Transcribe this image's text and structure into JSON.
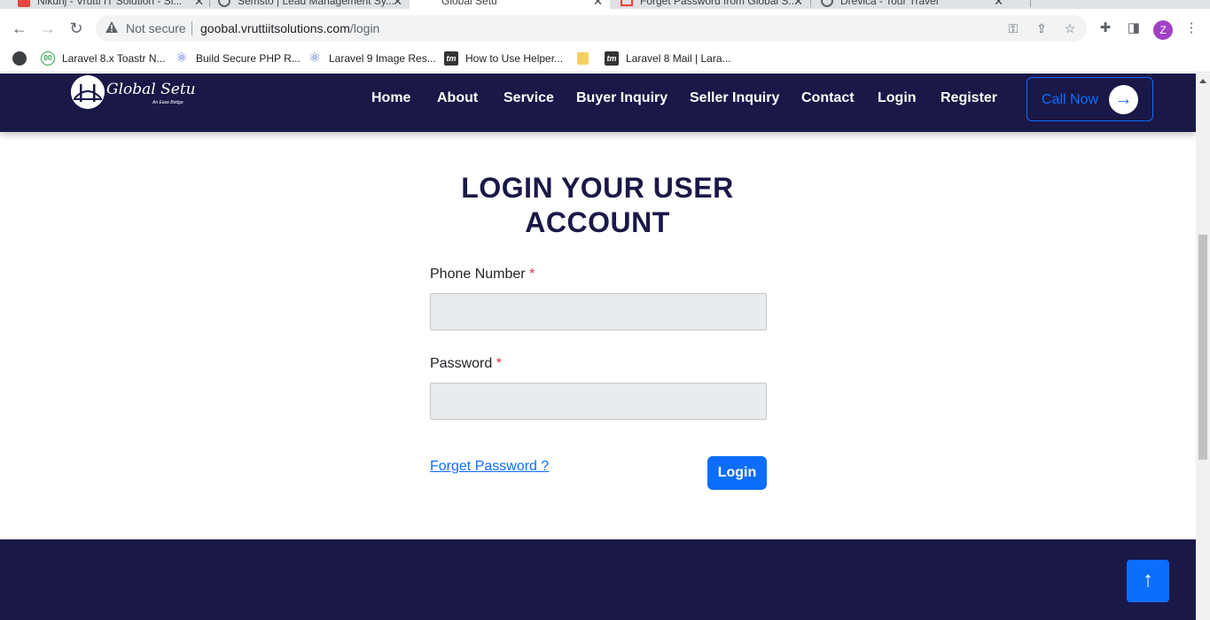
{
  "browser": {
    "tabs": [
      {
        "title": "Nikunj - Vrutti IT Solution - Sl...",
        "active": false
      },
      {
        "title": "Semsto | Lead Management Sy...",
        "active": false
      },
      {
        "title": "Global Setu",
        "active": true
      },
      {
        "title": "Forget Password from Global S...",
        "active": false
      },
      {
        "title": "Drevica - Tour Travel",
        "active": false
      }
    ],
    "security_label": "Not secure",
    "url_host": "goobal.vruttiitsolutions.com",
    "url_path": "/login",
    "profile_initial": "Z",
    "profile_color": "#a142c6",
    "bookmarks": [
      {
        "label": "Laravel 8.x Toastr N...",
        "icon": "laravel-icon"
      },
      {
        "label": "Build Secure PHP R...",
        "icon": "react-icon"
      },
      {
        "label": "Laravel 9 Image Res...",
        "icon": "react-icon"
      },
      {
        "label": "How to Use Helper...",
        "icon": "tm-icon"
      },
      {
        "label": "",
        "icon": "folder-icon"
      },
      {
        "label": "Laravel 8 Mail | Lara...",
        "icon": "tm-icon"
      }
    ]
  },
  "site": {
    "logo_text": "Global Setu",
    "logo_tagline": "An Ease Bridge",
    "nav": [
      "Home",
      "About",
      "Service",
      "Buyer Inquiry",
      "Seller Inquiry",
      "Contact",
      "Login",
      "Register"
    ],
    "call_label": "Call Now",
    "header_color": "#1a1847",
    "accent_color": "#0d6efd"
  },
  "login": {
    "title": "LOGIN YOUR USER ACCOUNT",
    "phone_label": "Phone Number",
    "phone_value": "",
    "password_label": "Password",
    "password_value": "",
    "required_mark": "*",
    "forget_label": "Forget Password ?",
    "submit_label": "Login"
  }
}
